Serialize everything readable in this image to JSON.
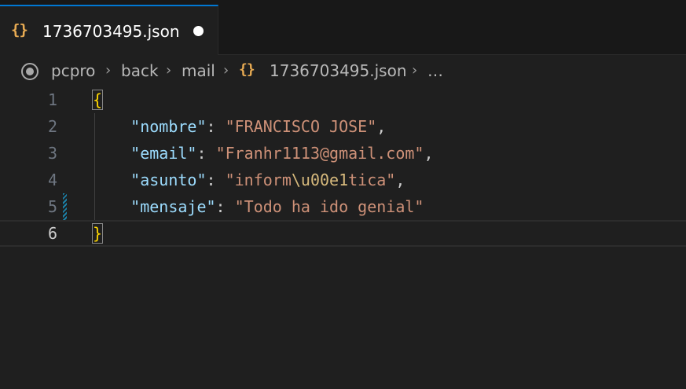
{
  "tab": {
    "icon": "{}",
    "icon_name": "json-braces-icon",
    "title": "1736703495.json",
    "unsaved": true
  },
  "breadcrumb": {
    "items": [
      "pcpro",
      "back",
      "mail"
    ],
    "file_icon": "{}",
    "file": "1736703495.json",
    "more": "…"
  },
  "editor": {
    "line_numbers": [
      "1",
      "2",
      "3",
      "4",
      "5",
      "6"
    ],
    "current_line": "6",
    "open_brace": "{",
    "close_brace": "}",
    "entries": [
      {
        "key": "\"nombre\"",
        "sep": ": ",
        "value": "\"FRANCISCO JOSE\"",
        "trail": ","
      },
      {
        "key": "\"email\"",
        "sep": ": ",
        "value": "\"Franhr1113@gmail.com\"",
        "trail": ","
      },
      {
        "key": "\"asunto\"",
        "sep": ": ",
        "value_prefix": "\"inform",
        "value_escape": "\\u00e1",
        "value_suffix": "tica\"",
        "trail": ","
      },
      {
        "key": "\"mensaje\"",
        "sep": ": ",
        "value": "\"Todo ha ido genial\"",
        "trail": ""
      }
    ]
  },
  "colors": {
    "tab_accent": "#0078d4",
    "json_icon": "#e8ab53",
    "key": "#9cdcfe",
    "string": "#ce9178",
    "escape": "#d7ba7d",
    "bracket": "#ffd700"
  }
}
